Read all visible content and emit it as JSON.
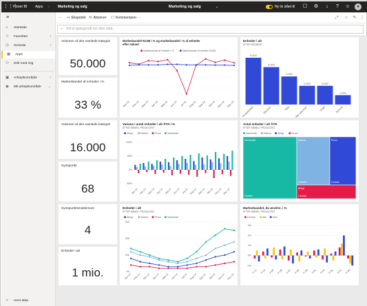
{
  "topbar": {
    "brand": "Power BI",
    "apps_crumb": "Apps",
    "crumb_current": "Marketing og salg",
    "center_title": "Marketing og salg",
    "new_look": "Ny lis slået til"
  },
  "nav": {
    "items": [
      {
        "label": "Startside",
        "icon": "home-icon"
      },
      {
        "label": "Favoritter",
        "icon": "star-icon"
      },
      {
        "label": "Seneste",
        "icon": "clock-icon"
      },
      {
        "label": "Apps",
        "icon": "apps-icon"
      },
      {
        "label": "Delt med mig",
        "icon": "shared-icon"
      },
      {
        "label": "Arbejdsområder",
        "icon": "workspaces-icon"
      },
      {
        "label": "Mit arbejdsområde",
        "icon": "my-workspace-icon"
      }
    ],
    "get_data": "Hent data"
  },
  "command_bar": {
    "export": "Eksportér",
    "subscribe": "Abonner",
    "comments": "Kommentarer",
    "more": "···"
  },
  "qna": {
    "placeholder": "Stil et spørgsmål om dine data"
  },
  "colors": {
    "accent": "#f2c811",
    "allegi": "#3049d6",
    "natura": "#7fb3e4",
    "pirum": "#e51b47",
    "vanArsdel": "#17b9a4",
    "topbar": "#252423"
  },
  "kpis": [
    {
      "title": "Volumen af den samlede kategori",
      "value": "50.000"
    },
    {
      "title": "Markedsandel af enheder i %",
      "value": "33 %"
    },
    {
      "title": "Volumen af den samlede kategori",
      "value": "16.000"
    },
    {
      "title": "Synspunkt",
      "value": "68"
    },
    {
      "title": "Synspunktsmaksimum",
      "value": "4"
    },
    {
      "title": "Enheder i alt",
      "value": "1 mio."
    }
  ],
  "tiles": {
    "market_share": {
      "title": "Markedsandel R12M i % og markedsandel i % af enheder",
      "title2": "efter måned",
      "legend": [
        "Markedsandel af enheder i %",
        "Markedsandel af enheder R12M"
      ]
    },
    "units_total": {
      "title": "Enheder i alt",
      "subtitle": "EFTER SEGMENT"
    },
    "variance": {
      "title": "Varians i antal enheder i alt ÅTD i %",
      "subtitle": "EFTER MÅNED, PRODUCENT",
      "legend": [
        "Allegi",
        "Natura",
        "Pirum",
        "VanArsdel"
      ]
    },
    "treemap": {
      "title": "Antal enheder i alt ÅTD",
      "subtitle": "EFTER MÅNED, PRODUCENT",
      "legend": [
        "VanArsdel",
        "Natura",
        "Allegi",
        "Pirum"
      ],
      "cells": [
        {
          "label": "VanArsdel",
          "sub": "Central"
        },
        {
          "label": "Natura",
          "sub": "Central"
        },
        {
          "label": "Pirum",
          "sub": "Central"
        },
        {
          "label": "Allegi",
          "sub": "Central"
        }
      ]
    },
    "units_monthly": {
      "title": "Enheder i alt",
      "subtitle": "EFTER MÅNED, PRODUCENT",
      "legend": [
        "Allegi",
        "Natura",
        "Pirum",
        "VanArsdel"
      ]
    },
    "share_change": {
      "title": "Markedsandel, du ændrer, i %",
      "subtitle": "EFTER MÅNED, PRODUCENT",
      "legend": [
        "Central",
        "Øst",
        "Vest"
      ]
    }
  },
  "chart_data": [
    {
      "type": "line",
      "title": "Markedsandel R12M i % og markedsandel i % af enheder efter måned",
      "categories": [
        "Jan-14",
        "Feb-14",
        "Mar-14",
        "Apr-14",
        "Maj-14",
        "Jun-14",
        "Jul-14",
        "Aug-14",
        "Sep-14",
        "Okt-14",
        "Nov-14",
        "Dec-14"
      ],
      "series": [
        {
          "name": "Markedsandel af enheder i %",
          "values": [
            34.0,
            33.5,
            34.8,
            34.5,
            35.2,
            31.0,
            22.0,
            33.0,
            35.5,
            34.2,
            35.0,
            34.0
          ]
        },
        {
          "name": "Markedsandel af enheder R12M",
          "values": [
            33.0,
            33.2,
            33.2,
            33.2,
            33.4,
            33.4,
            33.2,
            33.2,
            33.2,
            33.1,
            33.1,
            33.0
          ]
        }
      ]
    },
    {
      "type": "bar",
      "title": "Enheder i alt",
      "categories": [
        "Produktivitet",
        "Ekstrem",
        "Valg",
        "Alle sæsoner",
        "Unge",
        "Normal"
      ],
      "values": [
        5000,
        4000,
        3000,
        2000,
        2000,
        1000
      ],
      "data_labels": [
        "5.000",
        "4.000",
        "3.000",
        "2.000",
        "2.000",
        "1.000"
      ]
    },
    {
      "type": "bar",
      "title": "Varians i antal enheder i alt ÅTD i %",
      "categories": [
        "Jan-14",
        "Feb-14",
        "Mar-14",
        "Apr-14",
        "Maj-14",
        "Jun-14",
        "Jul-14",
        "Aug-14",
        "Sep-14",
        "Okt-14",
        "Nov-14",
        "Dec-14"
      ],
      "y_ticks": [
        "100%",
        "50%",
        "0%",
        "-50%"
      ],
      "series": [
        {
          "name": "Allegi",
          "values": [
            18,
            25,
            22,
            30,
            28,
            35,
            40,
            32,
            45,
            38,
            42,
            50
          ]
        },
        {
          "name": "Natura",
          "values": [
            10,
            12,
            15,
            20,
            14,
            22,
            25,
            18,
            20,
            28,
            24,
            30
          ]
        },
        {
          "name": "Pirum",
          "values": [
            -12,
            -8,
            -15,
            -10,
            -20,
            -14,
            -18,
            -25,
            -12,
            -30,
            -16,
            -22
          ]
        },
        {
          "name": "VanArsdel",
          "values": [
            22,
            30,
            35,
            40,
            45,
            50,
            55,
            60,
            52,
            65,
            58,
            70
          ]
        }
      ]
    },
    {
      "type": "line",
      "title": "Enheder i alt",
      "categories": [
        "Jan-14",
        "Feb-14",
        "Mar-14",
        "Apr-14",
        "Maj-14",
        "Jun-14",
        "Jul-14",
        "Aug-14",
        "Sep-14",
        "Okt-14",
        "Nov-14",
        "Dec-14"
      ],
      "y_ticks": [
        "30K",
        "20K",
        "10K",
        "0K"
      ],
      "series": [
        {
          "name": "Allegi",
          "values": [
            8,
            6,
            5,
            4,
            3,
            3,
            4,
            5,
            7,
            9,
            10,
            12
          ]
        },
        {
          "name": "Natura",
          "values": [
            12,
            10,
            9,
            7,
            6,
            5,
            6,
            8,
            10,
            14,
            16,
            18
          ]
        },
        {
          "name": "Pirum",
          "values": [
            4,
            3,
            3,
            2,
            2,
            2,
            2,
            3,
            3,
            4,
            5,
            6
          ]
        },
        {
          "name": "VanArsdel",
          "values": [
            14,
            12,
            10,
            8,
            7,
            6,
            8,
            12,
            18,
            22,
            26,
            25
          ]
        }
      ]
    },
    {
      "type": "bar",
      "title": "Markedsandel, du ændrer, i %",
      "categories": [
        "P-11",
        "P-10",
        "P-09",
        "P-08",
        "P-07",
        "P-06",
        "P-05",
        "P-04",
        "P-03",
        "P-02",
        "P-01",
        "P-00"
      ],
      "y_ticks": [
        "3%",
        "2%",
        "1%",
        "0%",
        "-1%"
      ],
      "series": [
        {
          "name": "Central",
          "values": [
            -0.3,
            0.4,
            -0.2,
            0.6,
            -0.5,
            0.3,
            -0.1,
            0.5,
            -0.4,
            0.2,
            0.8,
            -0.3
          ]
        },
        {
          "name": "Øst",
          "values": [
            0.5,
            -0.3,
            0.8,
            -0.4,
            0.6,
            -0.6,
            0.4,
            -0.2,
            0.7,
            -0.5,
            1.2,
            -0.8
          ]
        },
        {
          "name": "Vest",
          "values": [
            -0.6,
            0.7,
            -0.4,
            0.9,
            -0.8,
            0.5,
            -0.3,
            0.6,
            -0.7,
            0.4,
            2.0,
            -1.0
          ]
        }
      ]
    }
  ]
}
